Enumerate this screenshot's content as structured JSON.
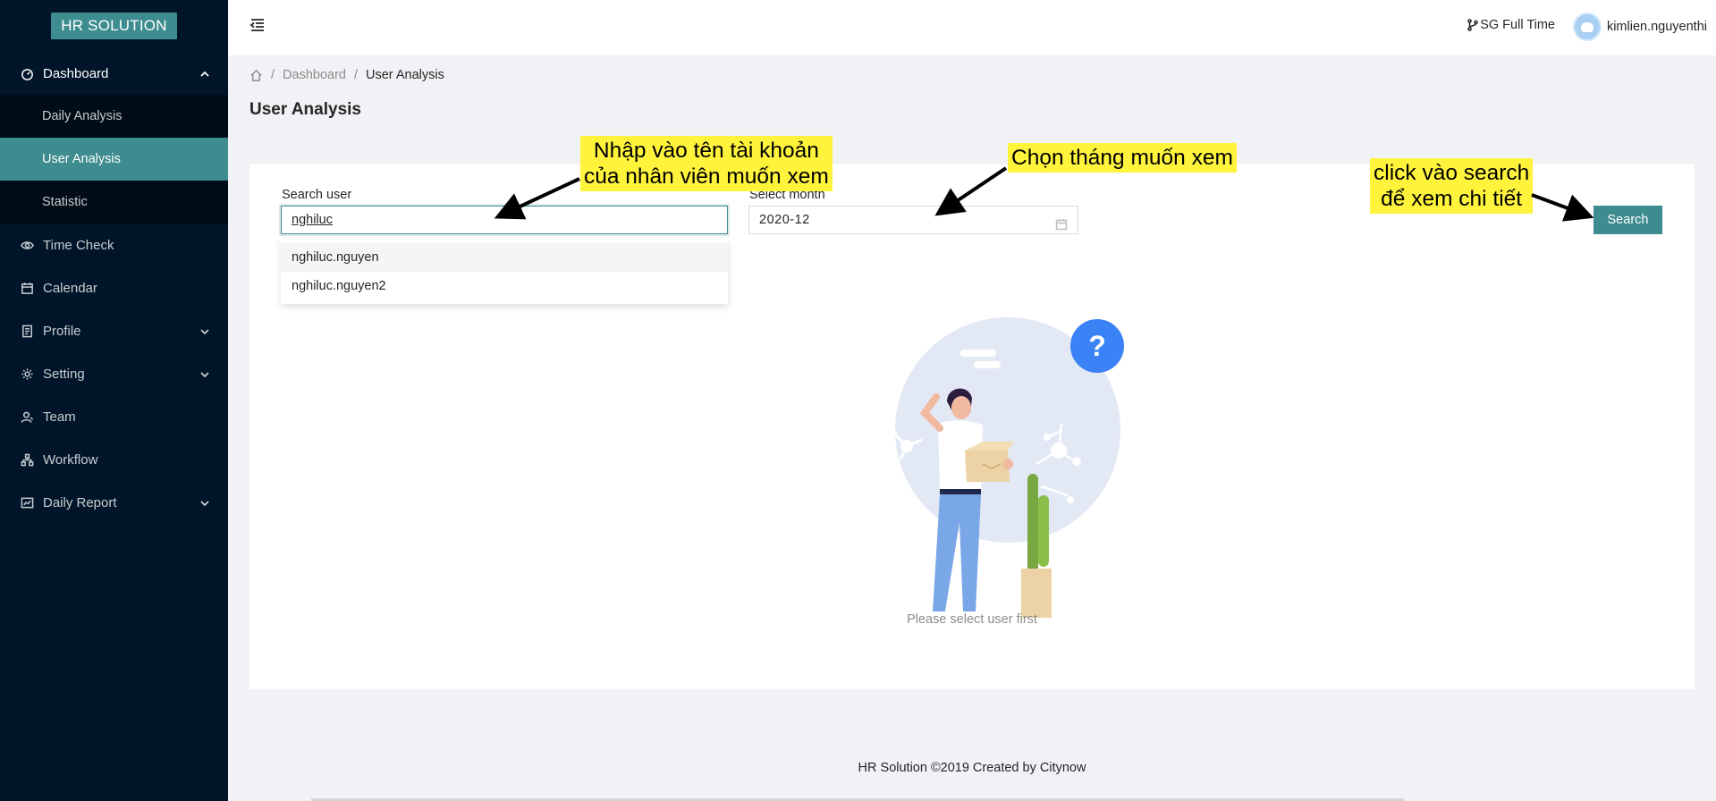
{
  "app": {
    "logo": "HR SOLUTION"
  },
  "sidebar": {
    "items": [
      {
        "label": "Dashboard",
        "icon": "dashboard-icon",
        "open": true,
        "children": [
          {
            "label": "Daily Analysis"
          },
          {
            "label": "User Analysis",
            "active": true
          },
          {
            "label": "Statistic"
          }
        ]
      },
      {
        "label": "Time Check",
        "icon": "eye-icon"
      },
      {
        "label": "Calendar",
        "icon": "calendar-icon"
      },
      {
        "label": "Profile",
        "icon": "profile-icon",
        "has_children": true
      },
      {
        "label": "Setting",
        "icon": "gear-icon",
        "has_children": true
      },
      {
        "label": "Team",
        "icon": "team-icon"
      },
      {
        "label": "Workflow",
        "icon": "workflow-icon"
      },
      {
        "label": "Daily Report",
        "icon": "report-icon",
        "has_children": true
      }
    ]
  },
  "header": {
    "branch": "SG Full Time",
    "username": "kimlien.nguyenthi"
  },
  "breadcrumb": {
    "items": [
      "Dashboard",
      "User Analysis"
    ]
  },
  "page": {
    "title": "User Analysis"
  },
  "form": {
    "search_label": "Search user",
    "search_value": "nghiluc",
    "suggestions": [
      "nghiluc.nguyen",
      "nghiluc.nguyen2"
    ],
    "month_label": "Select month",
    "month_value": "2020-12",
    "search_button": "Search"
  },
  "empty_state": {
    "text": "Please select user first"
  },
  "footer": {
    "text": "HR Solution ©2019 Created by Citynow"
  },
  "annotations": {
    "note1_line1": "Nhập vào tên tài khoản",
    "note1_line2": "của nhân viên muốn xem",
    "note2": "Chọn tháng muốn xem",
    "note3_line1": "click vào search",
    "note3_line2": "để xem chi tiết"
  },
  "colors": {
    "sidebar": "#001529",
    "submenu": "#000c17",
    "accent": "#3d8c8f",
    "annotation": "#fff43b"
  }
}
